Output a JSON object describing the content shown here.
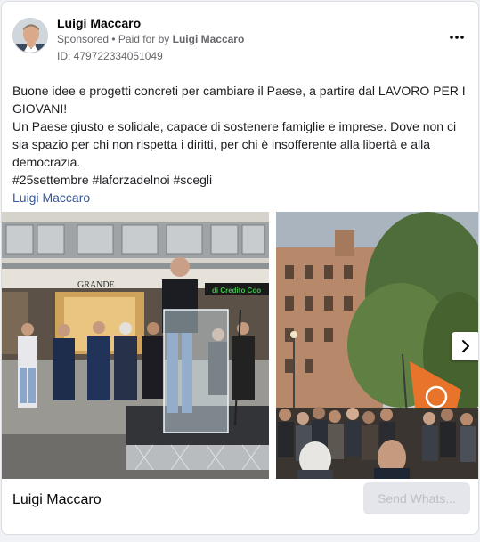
{
  "advertiser": {
    "name": "Luigi Maccaro",
    "sponsored_label": "Sponsored",
    "separator": " • ",
    "paid_for_prefix": "Paid for by ",
    "paid_for_name": "Luigi Maccaro",
    "ad_id": "ID: 479722334051049",
    "more_icon": "more-dots-icon"
  },
  "body": {
    "line1": "Buone idee e progetti concreti per cambiare il Paese, a partire dal LAVORO PER I GIOVANI!",
    "line2": "Un Paese giusto e solidale, capace di sostenere famiglie e imprese. Dove non ci sia spazio per chi non rispetta i diritti, per chi è insofferente alla libertà e alla democrazia.",
    "hashtags": "#25settembre #laforzadelnoi #scegli",
    "link": "Luigi Maccaro"
  },
  "carousel": {
    "slide1": {
      "sign_text": "GRANDE",
      "bank_sign": "di Credito Coo"
    },
    "next_icon": "chevron-right-icon"
  },
  "footer": {
    "title": "Luigi Maccaro",
    "cta_label": "Send Whats..."
  },
  "colors": {
    "link": "#385898",
    "flag_orange": "#e8732a",
    "cta_bg": "#e4e6eb"
  }
}
